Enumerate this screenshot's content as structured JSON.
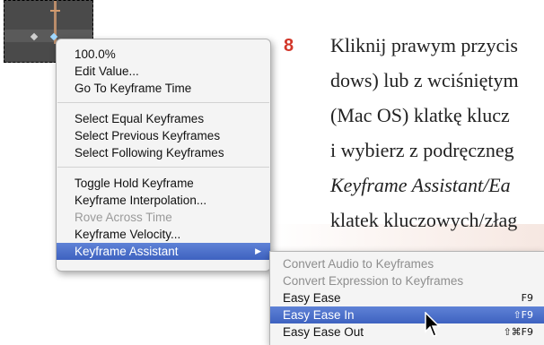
{
  "timeline": {
    "keyframes": [
      "plain",
      "selected"
    ]
  },
  "context_menu": {
    "items": [
      {
        "label": "100.0%",
        "state": "normal"
      },
      {
        "label": "Edit Value...",
        "state": "normal"
      },
      {
        "label": "Go To Keyframe Time",
        "state": "normal"
      },
      {
        "label": "Select Equal Keyframes",
        "state": "normal"
      },
      {
        "label": "Select Previous Keyframes",
        "state": "normal"
      },
      {
        "label": "Select Following Keyframes",
        "state": "normal"
      },
      {
        "label": "Toggle Hold Keyframe",
        "state": "normal"
      },
      {
        "label": "Keyframe Interpolation...",
        "state": "normal"
      },
      {
        "label": "Rove Across Time",
        "state": "disabled"
      },
      {
        "label": "Keyframe Velocity...",
        "state": "normal"
      },
      {
        "label": "Keyframe Assistant",
        "state": "highlighted",
        "submenu_arrow": "▶"
      }
    ]
  },
  "submenu": {
    "items": [
      {
        "label": "Convert Audio to Keyframes",
        "state": "disabled",
        "shortcut": ""
      },
      {
        "label": "Convert Expression to Keyframes",
        "state": "disabled",
        "shortcut": ""
      },
      {
        "label": "Easy Ease",
        "state": "normal",
        "shortcut": "F9"
      },
      {
        "label": "Easy Ease In",
        "state": "highlighted",
        "shortcut": "⇧F9"
      },
      {
        "label": "Easy Ease Out",
        "state": "normal",
        "shortcut": "⇧⌘F9"
      }
    ]
  },
  "instruction": {
    "step_number": "8",
    "lines": [
      "Kliknij prawym przycis",
      "dows) lub z wciśniętym",
      "(Mac OS) klatkę klucz",
      "i wybierz z podręczneg",
      "Keyframe Assistant/Ea",
      "klatek kluczowych/złag"
    ]
  },
  "colors": {
    "highlight": "#4a6fcf",
    "step_number": "#d2372a",
    "menu_background": "#f4f4f4"
  }
}
